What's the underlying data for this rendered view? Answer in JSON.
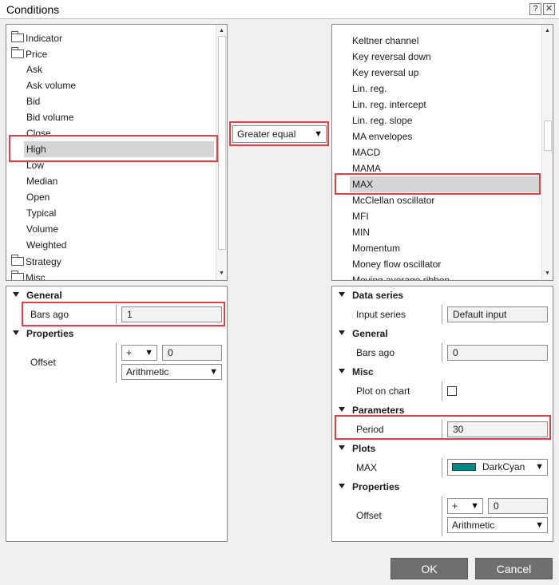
{
  "window": {
    "title": "Conditions",
    "help_label": "?",
    "close_label": "✕"
  },
  "left_tree": {
    "items": [
      {
        "label": "Indicator",
        "type": "folder"
      },
      {
        "label": "Price",
        "type": "folder"
      },
      {
        "label": "Ask"
      },
      {
        "label": "Ask volume"
      },
      {
        "label": "Bid"
      },
      {
        "label": "Bid volume"
      },
      {
        "label": "Close"
      },
      {
        "label": "High",
        "selected": true
      },
      {
        "label": "Low"
      },
      {
        "label": "Median"
      },
      {
        "label": "Open"
      },
      {
        "label": "Typical"
      },
      {
        "label": "Volume"
      },
      {
        "label": "Weighted"
      },
      {
        "label": "Strategy",
        "type": "folder"
      },
      {
        "label": "Misc",
        "type": "folder"
      }
    ]
  },
  "operator": {
    "selected": "Greater equal"
  },
  "right_list": {
    "items": [
      "Keltner channel",
      "Key reversal down",
      "Key reversal up",
      "Lin. reg.",
      "Lin. reg. intercept",
      "Lin. reg. slope",
      "MA envelopes",
      "MACD",
      "MAMA",
      "MAX",
      "McClellan oscillator",
      "MFI",
      "MIN",
      "Momentum",
      "Money flow oscillator",
      "Moving average ribbon"
    ],
    "selected": "MAX"
  },
  "left_props": {
    "general_header": "General",
    "bars_ago_label": "Bars ago",
    "bars_ago_value": "1",
    "properties_header": "Properties",
    "offset_label": "Offset",
    "offset_sign": "+",
    "offset_value": "0",
    "offset_type": "Arithmetic"
  },
  "right_props": {
    "data_series_header": "Data series",
    "input_series_label": "Input series",
    "input_series_value": "Default input",
    "general_header": "General",
    "bars_ago_label": "Bars ago",
    "bars_ago_value": "0",
    "misc_header": "Misc",
    "plot_on_chart_label": "Plot on chart",
    "plot_on_chart_checked": false,
    "parameters_header": "Parameters",
    "period_label": "Period",
    "period_value": "30",
    "plots_header": "Plots",
    "max_label": "MAX",
    "max_color_name": "DarkCyan",
    "max_color_hex": "#008b8b",
    "properties_header": "Properties",
    "offset_label": "Offset",
    "offset_sign": "+",
    "offset_value": "0",
    "offset_type": "Arithmetic"
  },
  "buttons": {
    "ok": "OK",
    "cancel": "Cancel"
  }
}
